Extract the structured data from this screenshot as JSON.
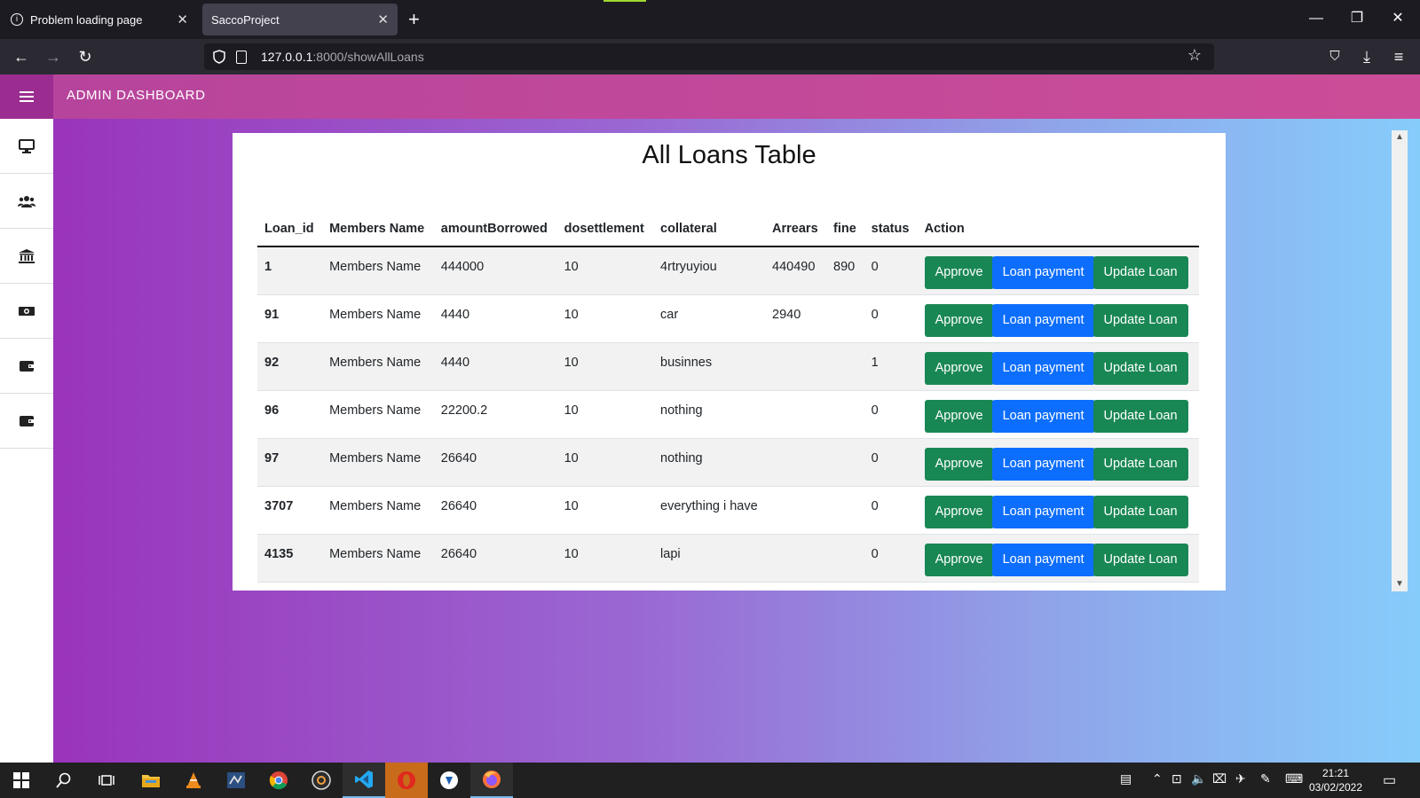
{
  "browser": {
    "tabs": [
      {
        "title": "Problem loading page"
      },
      {
        "title": "SaccoProject"
      }
    ],
    "url_host": "127.0.0.1",
    "url_path": ":8000/showAllLoans"
  },
  "app": {
    "brand": "ADMIN DASHBOARD",
    "sidebar_icons": [
      "desktop-icon",
      "users-icon",
      "bank-icon",
      "money-icon",
      "wallet-icon",
      "wallet-icon"
    ]
  },
  "page": {
    "title": "All Loans Table"
  },
  "table": {
    "headers": [
      "Loan_id",
      "Members Name",
      "amountBorrowed",
      "dosettlement",
      "collateral",
      "Arrears",
      "fine",
      "status",
      "Action"
    ],
    "rows": [
      {
        "id": "1",
        "name": "Members Name",
        "amount": "444000",
        "dos": "10",
        "collateral": "4rtryuyiou",
        "arrears": "440490",
        "fine": "890",
        "status": "0"
      },
      {
        "id": "91",
        "name": "Members Name",
        "amount": "4440",
        "dos": "10",
        "collateral": "car",
        "arrears": "2940",
        "fine": "",
        "status": "0"
      },
      {
        "id": "92",
        "name": "Members Name",
        "amount": "4440",
        "dos": "10",
        "collateral": "businnes",
        "arrears": "",
        "fine": "",
        "status": "1"
      },
      {
        "id": "96",
        "name": "Members Name",
        "amount": "22200.2",
        "dos": "10",
        "collateral": "nothing",
        "arrears": "",
        "fine": "",
        "status": "0"
      },
      {
        "id": "97",
        "name": "Members Name",
        "amount": "26640",
        "dos": "10",
        "collateral": "nothing",
        "arrears": "",
        "fine": "",
        "status": "0"
      },
      {
        "id": "3707",
        "name": "Members Name",
        "amount": "26640",
        "dos": "10",
        "collateral": "everything i have",
        "arrears": "",
        "fine": "",
        "status": "0"
      },
      {
        "id": "4135",
        "name": "Members Name",
        "amount": "26640",
        "dos": "10",
        "collateral": "lapi",
        "arrears": "",
        "fine": "",
        "status": "0"
      }
    ],
    "actions": {
      "approve": "Approve",
      "payment": "Loan payment",
      "update": "Update Loan"
    }
  },
  "taskbar": {
    "time": "21:21",
    "date": "03/02/2022"
  },
  "colors": {
    "topbar": "#c04a99",
    "approve": "#198754",
    "payment": "#0d6efd"
  }
}
